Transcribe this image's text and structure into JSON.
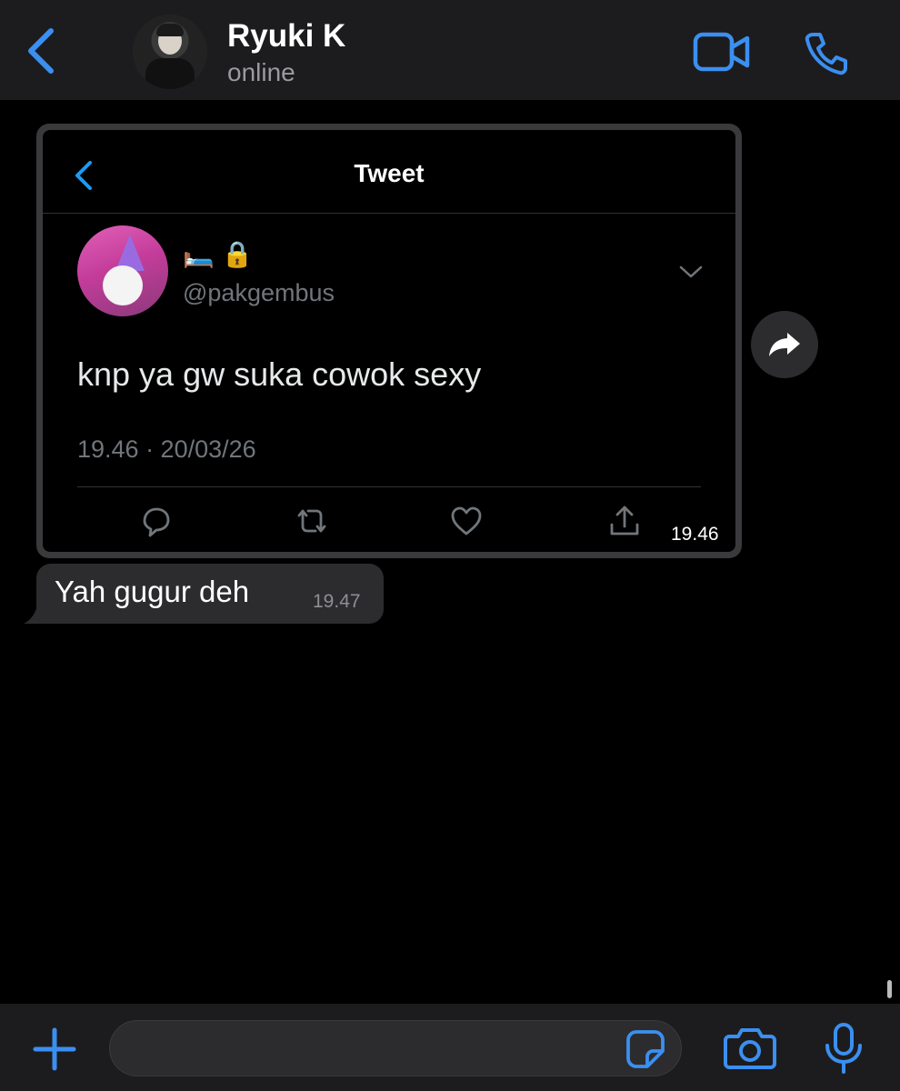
{
  "header": {
    "contact_name": "Ryuki K",
    "status": "online"
  },
  "messages": [
    {
      "type": "image",
      "time": "19.46",
      "tweet": {
        "title": "Tweet",
        "display_emoji": "🛏️ 🔒",
        "handle": "@pakgembus",
        "text": "knp ya gw suka cowok sexy",
        "timestamp": "19.46 · 20/03/26"
      }
    },
    {
      "type": "text",
      "text": "Yah gugur deh",
      "time": "19.47"
    }
  ],
  "input": {
    "placeholder": "",
    "value": ""
  },
  "colors": {
    "accent": "#3b8ff0",
    "background": "#000000",
    "bar": "#1c1c1e",
    "bubble": "#2c2c2e"
  },
  "icons": [
    "chevron-left-icon",
    "video-call-icon",
    "phone-icon",
    "forward-icon",
    "reply-icon",
    "retweet-icon",
    "heart-icon",
    "share-icon",
    "plus-icon",
    "sticker-icon",
    "camera-icon",
    "microphone-icon"
  ]
}
